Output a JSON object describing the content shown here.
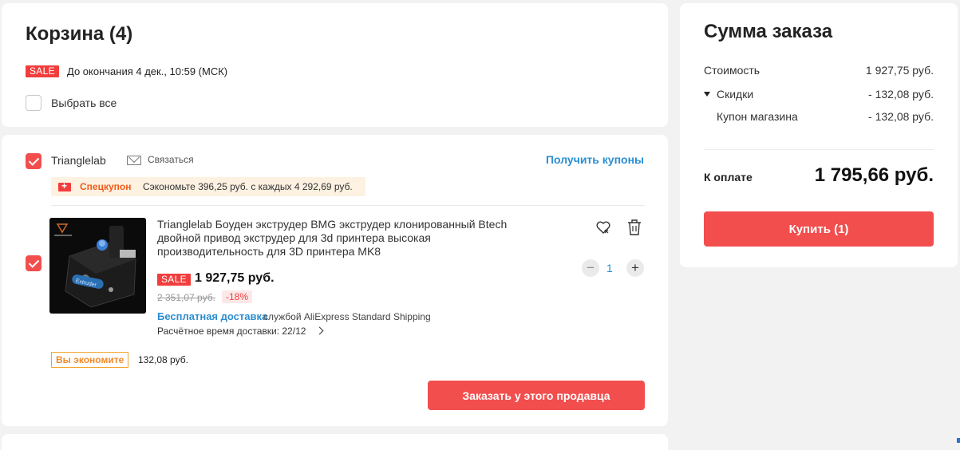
{
  "cart": {
    "title": "Корзина (4)",
    "sale_badge": "SALE",
    "sale_deadline": "До окончания 4 дек., 10:59 (МСК)",
    "select_all_label": "Выбрать все"
  },
  "seller": {
    "name": "Trianglelab",
    "contact_label": "Связаться",
    "get_coupons_label": "Получить купоны",
    "promo_title": "Спецкупон",
    "promo_text": "Сэкономьте 396,25 руб. с каждых 4 292,69 руб.",
    "order_button_label": "Заказать у этого продавца",
    "savings_badge": "Вы экономите",
    "savings_amount": "132,08 руб."
  },
  "item": {
    "title": "Trianglelab Боуден экструдер BMG экструдер клонированный Btech двойной привод экструдер для 3d принтера высокая производительность для 3D принтера MK8",
    "sale_badge": "SALE",
    "price": "1 927,75 руб.",
    "old_price": "2 351,07 руб.",
    "discount": "-18%",
    "free_delivery": "Бесплатная доставка",
    "shipping_service": "службой AliExpress Standard Shipping",
    "delivery_time": "Расчётное время доставки: 22/12",
    "quantity": "1",
    "qty_minus": "−",
    "qty_plus": "+",
    "image_caption": "Extruder"
  },
  "summary": {
    "title": "Сумма заказа",
    "cost_label": "Стоимость",
    "cost_value": "1 927,75 руб.",
    "discounts_label": "Скидки",
    "discounts_value": "- 132,08 руб.",
    "coupon_label": "Купон магазина",
    "coupon_value": "- 132,08 руб.",
    "total_label": "К оплате",
    "total_value": "1 795,66 руб.",
    "buy_button_label": "Купить (1)"
  },
  "colors": {
    "accent_red": "#f24e4e",
    "link_blue": "#2b8ed1",
    "promo_orange": "#f25b1a"
  }
}
